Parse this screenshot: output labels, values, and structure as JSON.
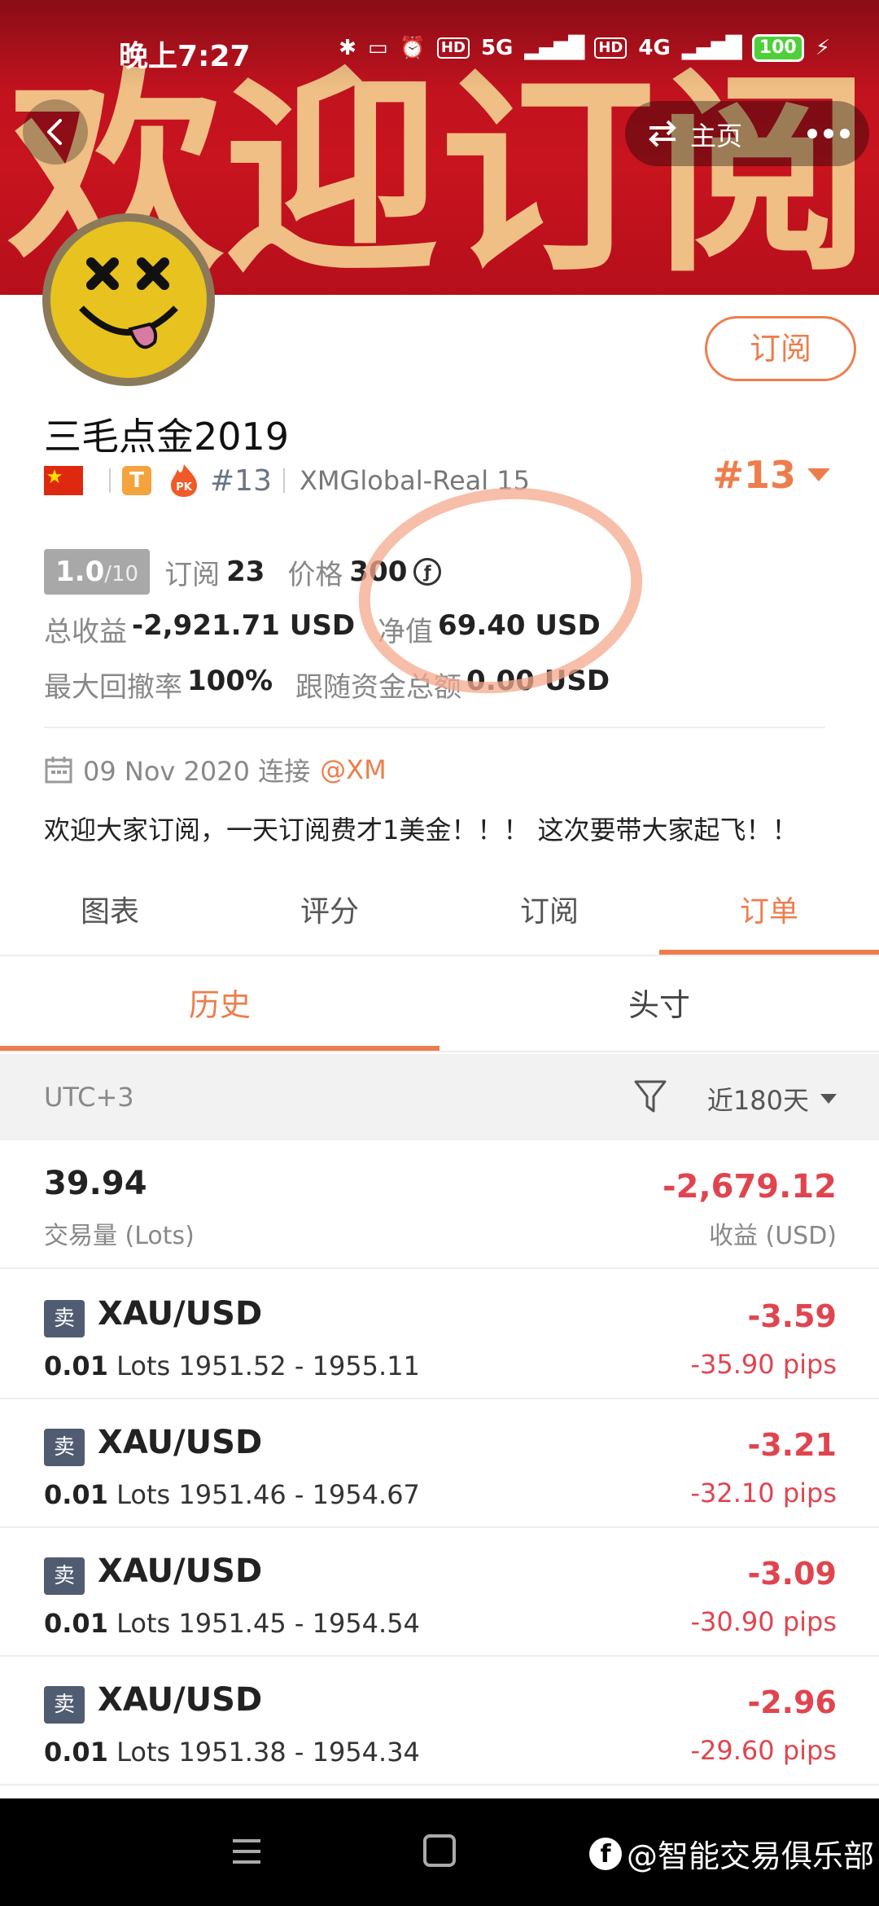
{
  "status": {
    "time": "晚上7:27",
    "battery": "100",
    "network1": "5G",
    "network2": "4G",
    "hd": "HD"
  },
  "banner": {
    "text": "欢迎订阅"
  },
  "nav": {
    "home_label": "主页"
  },
  "profile": {
    "name": "三毛点金2019",
    "subscribe_label": "订阅",
    "t_badge": "T",
    "rank_small": "#13",
    "broker": "XMGlobal-Real 15",
    "rank_big": "#13",
    "rating": "1.0",
    "rating_max": "/10",
    "subscribers_label": "订阅",
    "subscribers": "23",
    "price_label": "价格",
    "price": "300",
    "coin_symbol": "ƒ",
    "total_profit_label": "总收益",
    "total_profit": "-2,921.71 USD",
    "equity_label": "净值",
    "equity": "69.40 USD",
    "drawdown_label": "最大回撤率",
    "drawdown": "100%",
    "follow_funds_label": "跟随资金总额",
    "follow_funds": "0.00 USD",
    "join_date": "09 Nov 2020 连接",
    "join_broker": "@XM",
    "description": "欢迎大家订阅，一天订阅费才1美金！！！ 这次要带大家起飞！！"
  },
  "tabs": [
    "图表",
    "评分",
    "订阅",
    "订单"
  ],
  "subtabs": [
    "历史",
    "头寸"
  ],
  "filter": {
    "timezone": "UTC+3",
    "range": "近180天"
  },
  "summary": {
    "lots": "39.94",
    "lots_label": "交易量 (Lots)",
    "profit": "-2,679.12",
    "profit_label": "收益 (USD)"
  },
  "orders": [
    {
      "side": "卖",
      "symbol": "XAU/USD",
      "lots": "0.01",
      "lots_unit": "Lots",
      "prices": "1951.52 - 1955.11",
      "profit": "-3.59",
      "pips": "-35.90 pips"
    },
    {
      "side": "卖",
      "symbol": "XAU/USD",
      "lots": "0.01",
      "lots_unit": "Lots",
      "prices": "1951.46 - 1954.67",
      "profit": "-3.21",
      "pips": "-32.10 pips"
    },
    {
      "side": "卖",
      "symbol": "XAU/USD",
      "lots": "0.01",
      "lots_unit": "Lots",
      "prices": "1951.45 - 1954.54",
      "profit": "-3.09",
      "pips": "-30.90 pips"
    },
    {
      "side": "卖",
      "symbol": "XAU/USD",
      "lots": "0.01",
      "lots_unit": "Lots",
      "prices": "1951.38 - 1954.34",
      "profit": "-2.96",
      "pips": "-29.60 pips"
    }
  ],
  "watermark": "@智能交易俱乐部",
  "colors": {
    "accent": "#ee7d4d",
    "loss": "#e0454f",
    "banner": "#c8141f"
  }
}
